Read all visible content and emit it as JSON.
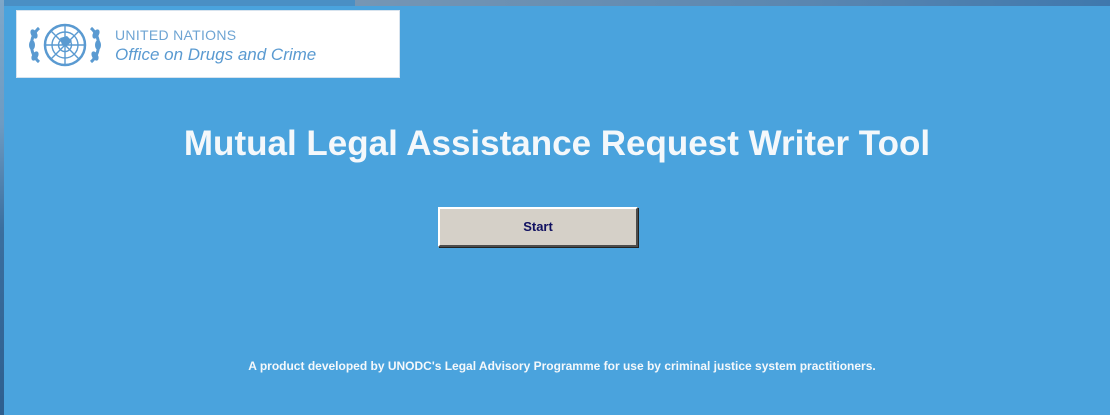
{
  "logo": {
    "org_name": "UNITED NATIONS",
    "office_name": "Office on Drugs and Crime",
    "emblem_icon": "un-emblem-icon"
  },
  "main": {
    "title": "Mutual Legal Assistance Request Writer Tool",
    "start_button_label": "Start",
    "footer": "A product developed by UNODC's Legal Advisory Programme for use by criminal justice system practitioners."
  },
  "colors": {
    "panel_background": "#4aa3dd",
    "title_text": "#f4f8fb",
    "button_face": "#d5d0c8",
    "button_text": "#101060",
    "logo_text": "#5a9ad1"
  }
}
